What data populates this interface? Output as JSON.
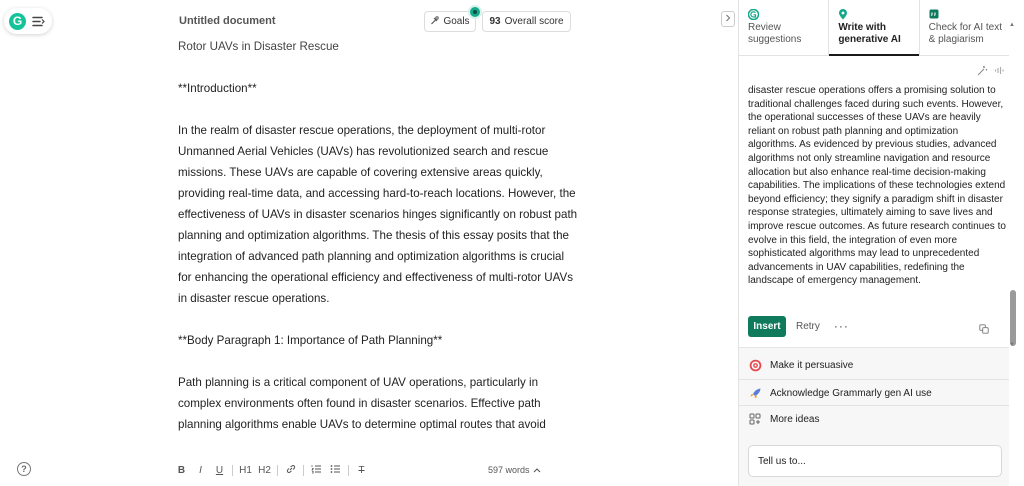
{
  "app": {
    "logo_letter": "G"
  },
  "header": {
    "doc_title": "Untitled document",
    "goals_label": "Goals",
    "score_value": "93",
    "score_label": "Overall score"
  },
  "document": {
    "paragraphs": [
      "Rotor UAVs in Disaster Rescue",
      "**Introduction**",
      "In the realm of disaster rescue operations, the deployment of multi-rotor Unmanned Aerial Vehicles (UAVs) has revolutionized search and rescue missions. These UAVs are capable of covering extensive areas quickly, providing real-time data, and accessing hard-to-reach locations. However, the effectiveness of UAVs in disaster scenarios hinges significantly on robust path planning and optimization algorithms. The thesis of this essay posits that the integration of advanced path planning and optimization algorithms is crucial for enhancing the operational efficiency and effectiveness of multi-rotor UAVs in disaster rescue operations.",
      "**Body Paragraph 1: Importance of Path Planning**",
      "Path planning is a critical component of UAV operations, particularly in complex environments often found in disaster scenarios. Effective path planning algorithms enable UAVs to determine optimal routes that avoid"
    ]
  },
  "toolbar": {
    "bold": "B",
    "italic": "I",
    "underline": "U",
    "h1": "H1",
    "h2": "H2",
    "clear": "T",
    "word_count": "597 words"
  },
  "panel": {
    "tabs": [
      {
        "label": "Review suggestions",
        "icon": "grammarly-icon"
      },
      {
        "label": "Write with generative AI",
        "icon": "ai-pin-icon"
      },
      {
        "label": "Check for AI text & plagiarism",
        "icon": "quote-icon"
      }
    ],
    "ai_response": "disaster rescue operations offers a promising solution to traditional challenges faced during such events. However, the operational successes of these UAVs are heavily reliant on robust path planning and optimization algorithms. As evidenced by previous studies, advanced algorithms not only streamline navigation and resource allocation but also enhance real-time decision-making capabilities. The implications of these technologies extend beyond efficiency; they signify a paradigm shift in disaster response strategies, ultimately aiming to save lives and improve rescue outcomes. As future research continues to evolve in this field, the integration of even more sophisticated algorithms may lead to unprecedented advancements in UAV capabilities, redefining the landscape of emergency management.",
    "insert_label": "Insert",
    "retry_label": "Retry",
    "more_label": "···",
    "suggestions": [
      {
        "label": "Make it persuasive",
        "icon": "target-icon"
      },
      {
        "label": "Acknowledge Grammarly gen AI use",
        "icon": "rocket-icon"
      },
      {
        "label": "More ideas",
        "icon": "grid-icon"
      }
    ],
    "prompt_placeholder": "Tell us to..."
  },
  "colors": {
    "brand": "#15c39a",
    "insert": "#0f7a5c"
  }
}
